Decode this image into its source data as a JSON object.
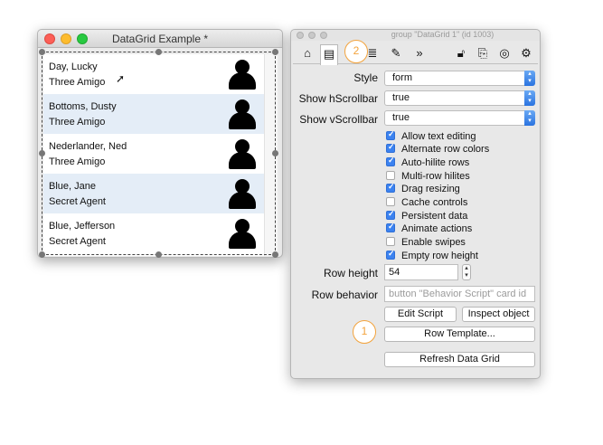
{
  "datagrid_window": {
    "title": "DataGrid Example *",
    "rows": [
      {
        "name": "Day, Lucky",
        "role": "Three Amigo"
      },
      {
        "name": "Bottoms, Dusty",
        "role": "Three Amigo"
      },
      {
        "name": "Nederlander, Ned",
        "role": "Three Amigo"
      },
      {
        "name": "Blue, Jane",
        "role": "Secret Agent"
      },
      {
        "name": "Blue, Jefferson",
        "role": "Secret Agent"
      }
    ]
  },
  "inspector": {
    "title": "group \"DataGrid 1\" (id 1003)",
    "toolbar_icons": [
      "home-icon",
      "card-icon",
      "database-icon",
      "pencil-icon",
      "chevron-double-right-icon",
      "lock-icon",
      "code-icon",
      "target-icon",
      "gear-icon"
    ],
    "style": {
      "label": "Style",
      "value": "form"
    },
    "show_hscrollbar": {
      "label": "Show hScrollbar",
      "value": "true"
    },
    "show_vscrollbar": {
      "label": "Show vScrollbar",
      "value": "true"
    },
    "options": [
      {
        "label": "Allow text editing",
        "checked": true
      },
      {
        "label": "Alternate row colors",
        "checked": true
      },
      {
        "label": "Auto-hilite rows",
        "checked": true
      },
      {
        "label": "Multi-row hilites",
        "checked": false
      },
      {
        "label": "Drag resizing",
        "checked": true
      },
      {
        "label": "Cache controls",
        "checked": false
      },
      {
        "label": "Persistent data",
        "checked": true
      },
      {
        "label": "Animate actions",
        "checked": true
      },
      {
        "label": "Enable swipes",
        "checked": false
      },
      {
        "label": "Empty row height",
        "checked": true
      }
    ],
    "row_height": {
      "label": "Row height",
      "value": "54"
    },
    "row_behavior": {
      "label": "Row behavior",
      "placeholder": "button \"Behavior Script\" card id"
    },
    "buttons": {
      "edit_script": "Edit Script",
      "inspect_object": "Inspect object",
      "row_template": "Row Template...",
      "refresh": "Refresh Data Grid"
    }
  },
  "callouts": {
    "one": "1",
    "two": "2",
    "color": "#f3a33c"
  }
}
